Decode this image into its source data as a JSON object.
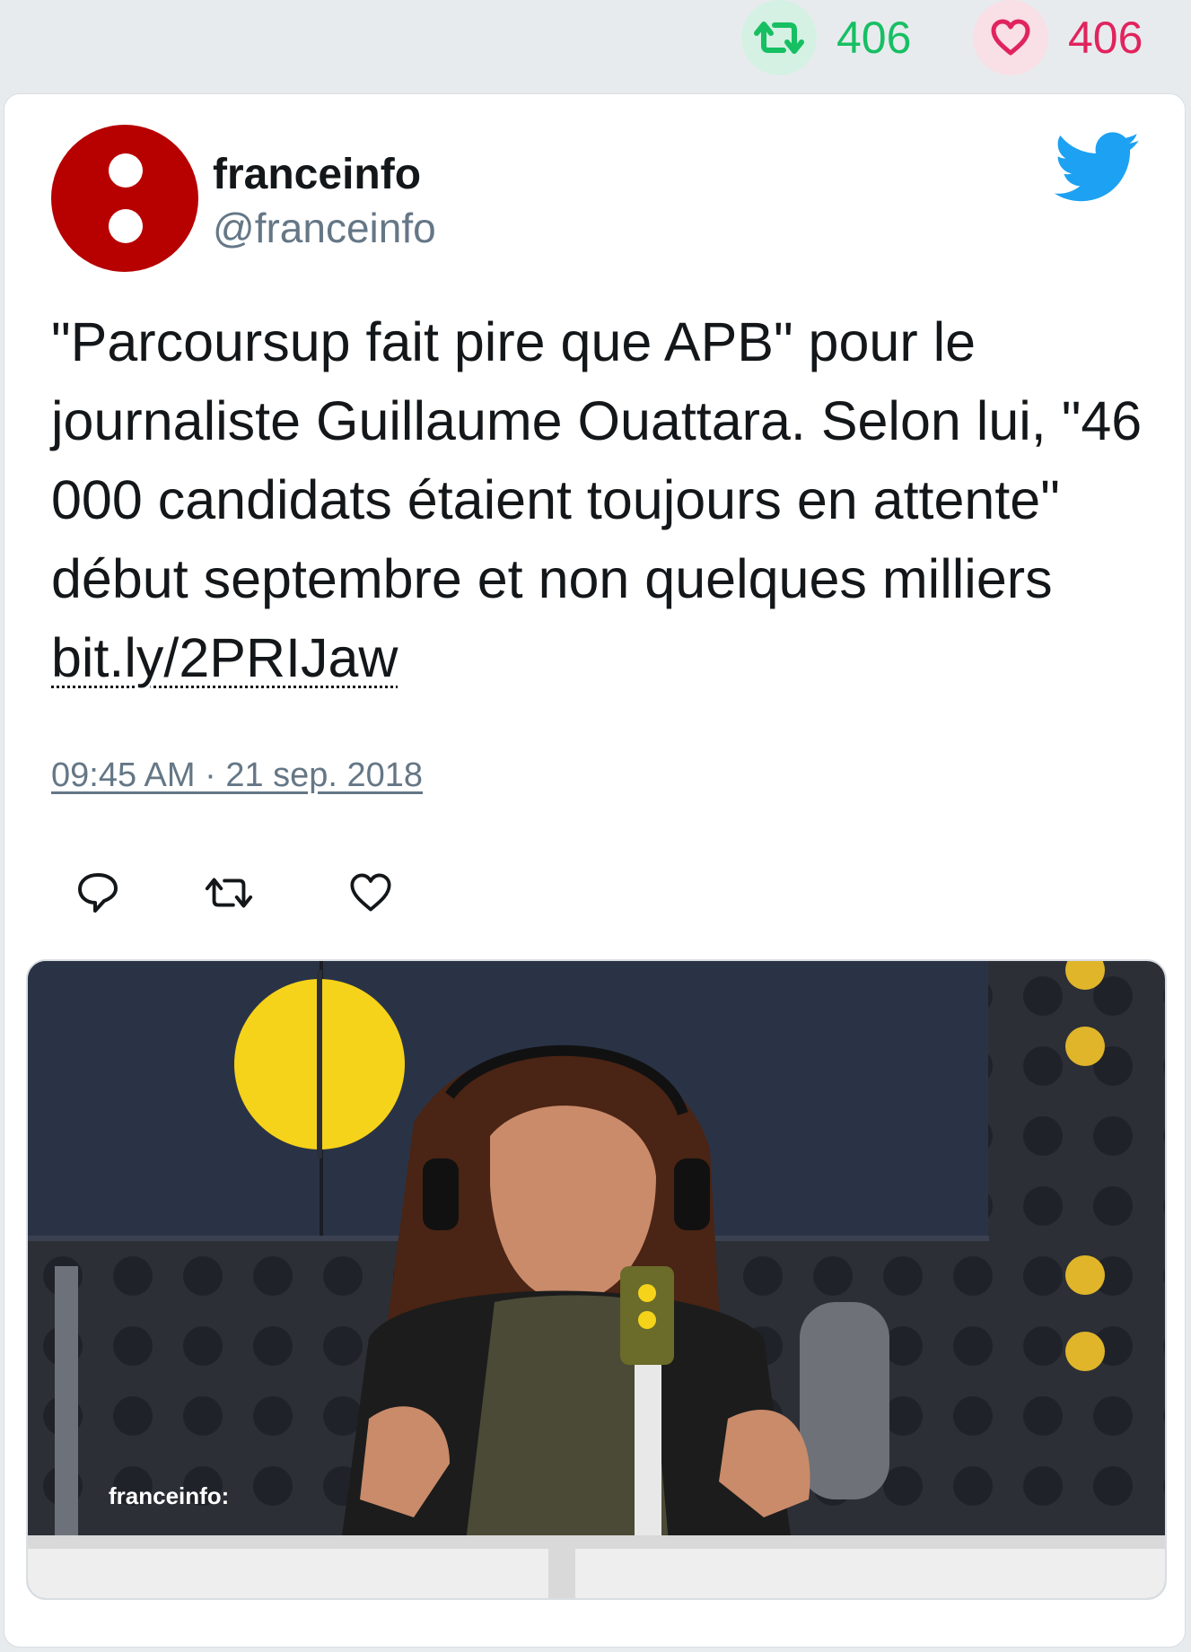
{
  "stats": {
    "retweet_count": "406",
    "like_count": "406"
  },
  "tweet": {
    "author_name": "franceinfo",
    "author_handle": "@franceinfo",
    "text": "\"Parcoursup fait pire que APB\" pour le journaliste Guillaume Ouattara. Selon lui, \"46 000 candidats étaient toujours en attente\" début septembre et non quelques milliers ",
    "link": "bit.ly/2PRIJaw",
    "timestamp": "09:45 AM · 21 sep. 2018"
  },
  "media": {
    "watermark": "franceinfo:"
  },
  "colors": {
    "retweet_green": "#17bf63",
    "like_red": "#e0245e",
    "twitter_blue": "#1da1f2",
    "avatar_red": "#b70000",
    "muted_gray": "#657786"
  },
  "icons": [
    "retweet-icon",
    "heart-icon",
    "twitter-bird-icon",
    "reply-icon"
  ]
}
